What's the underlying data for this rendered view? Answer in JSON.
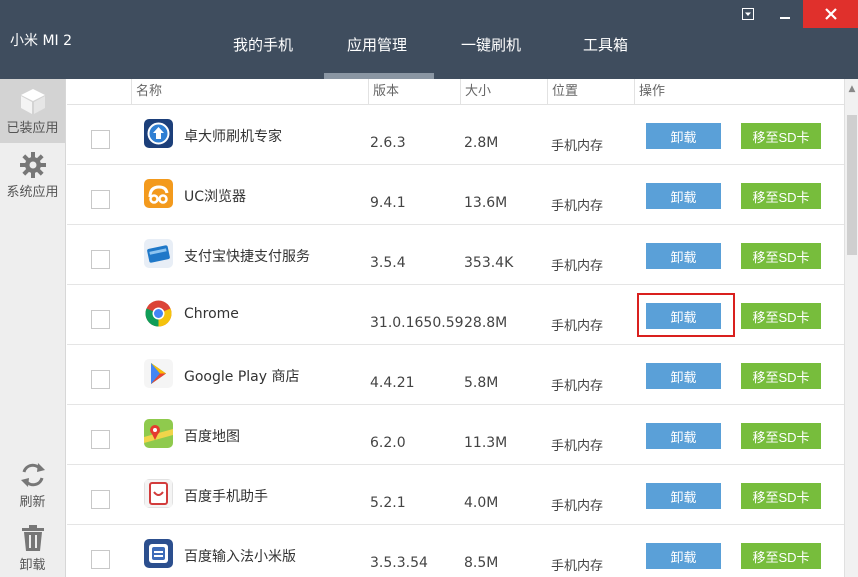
{
  "device": {
    "name": "小米 MI 2"
  },
  "tabs": [
    {
      "label": "我的手机"
    },
    {
      "label": "应用管理"
    },
    {
      "label": "一键刷机"
    },
    {
      "label": "工具箱"
    }
  ],
  "active_tab": "应用管理",
  "sidebar": {
    "installed_label": "已装应用",
    "system_label": "系统应用",
    "refresh_label": "刷新",
    "uninstall_label": "卸载"
  },
  "table": {
    "headers": {
      "name": "名称",
      "version": "版本",
      "size": "大小",
      "location": "位置",
      "action": "操作"
    },
    "uninstall_label": "卸载",
    "move_sd_label": "移至SD卡",
    "rows": [
      {
        "name": "卓大师刷机专家",
        "version": "2.6.3",
        "size": "2.8M",
        "location": "手机内存",
        "icon": "zhuodashi-icon"
      },
      {
        "name": "UC浏览器",
        "version": "9.4.1",
        "size": "13.6M",
        "location": "手机内存",
        "icon": "uc-browser-icon"
      },
      {
        "name": "支付宝快捷支付服务",
        "version": "3.5.4",
        "size": "353.4K",
        "location": "手机内存",
        "icon": "alipay-icon"
      },
      {
        "name": "Chrome",
        "version": "31.0.1650.59",
        "size": "28.8M",
        "location": "手机内存",
        "icon": "chrome-icon"
      },
      {
        "name": "Google Play 商店",
        "version": "4.4.21",
        "size": "5.8M",
        "location": "手机内存",
        "icon": "google-play-icon"
      },
      {
        "name": "百度地图",
        "version": "6.2.0",
        "size": "11.3M",
        "location": "手机内存",
        "icon": "baidu-map-icon"
      },
      {
        "name": "百度手机助手",
        "version": "5.2.1",
        "size": "4.0M",
        "location": "手机内存",
        "icon": "baidu-assistant-icon"
      },
      {
        "name": "百度输入法小米版",
        "version": "3.5.3.54",
        "size": "8.5M",
        "location": "手机内存",
        "icon": "baidu-input-icon"
      }
    ]
  },
  "colors": {
    "topbar": "#3f4d5e",
    "uninstall_button": "#5aa0d8",
    "move_sd_button": "#77bd3c",
    "close_button": "#e0302c",
    "highlight_box": "#d9201e"
  }
}
